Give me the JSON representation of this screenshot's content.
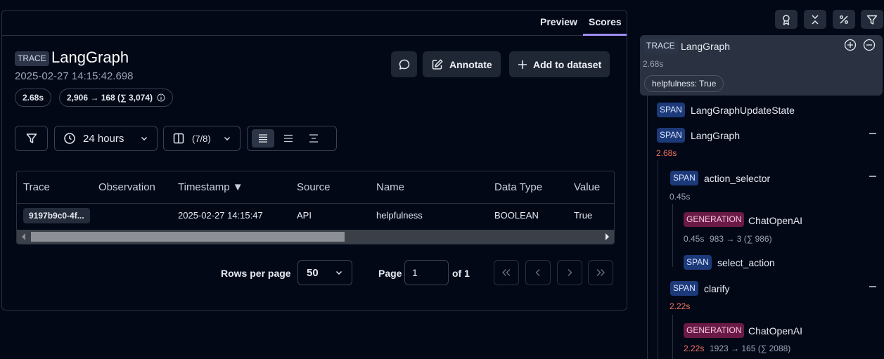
{
  "tabs": [
    {
      "label": "Preview"
    },
    {
      "label": "Scores"
    }
  ],
  "trace": {
    "badge": "TRACE",
    "name": "LangGraph",
    "timestamp": "2025-02-27 14:15:42.698",
    "latency": "2.68s",
    "tokens": "2,906 → 168 (∑ 3,074)"
  },
  "actions": {
    "annotate": "Annotate",
    "add_to_dataset": "Add to dataset"
  },
  "filters": {
    "time_range": "24 hours",
    "columns": "(7/8)"
  },
  "table": {
    "columns": [
      "Trace",
      "Observation",
      "Timestamp ▼",
      "Source",
      "Name",
      "Data Type",
      "Value"
    ],
    "rows": [
      {
        "trace": "9197b9c0-4f...",
        "observation": "",
        "timestamp": "2025-02-27 14:15:47",
        "source": "API",
        "name": "helpfulness",
        "data_type": "BOOLEAN",
        "value": "True"
      }
    ],
    "scroll_fraction": 0.55
  },
  "pagination": {
    "rows_label": "Rows per page",
    "rows_value": "50",
    "page_label": "Page",
    "page_value": "1",
    "of_label": "of 1"
  },
  "tree": {
    "root": {
      "badge": "TRACE",
      "name": "LangGraph",
      "duration": "2.68s",
      "score": "helpfulness: True"
    },
    "nodes": [
      {
        "badge": "SPAN",
        "name": "LangGraphUpdateState"
      },
      {
        "badge": "SPAN",
        "name": "LangGraph",
        "duration": "2.68s"
      },
      {
        "badge": "SPAN",
        "name": "action_selector",
        "duration": "0.45s"
      },
      {
        "badge": "GENERATION",
        "name": "ChatOpenAI",
        "duration": "0.45s",
        "tokens": "983 → 3 (∑ 986)"
      },
      {
        "badge": "SPAN",
        "name": "select_action"
      },
      {
        "badge": "SPAN",
        "name": "clarify",
        "duration": "2.22s"
      },
      {
        "badge": "GENERATION",
        "name": "ChatOpenAI",
        "duration": "2.22s",
        "tokens": "1923 → 165 (∑ 2088)"
      }
    ]
  },
  "colors": {
    "background": "#030817",
    "active_tab": "#9d8cf5",
    "span_badge": "#1c3a7a",
    "generation_badge": "#6b1a47",
    "slow_duration": "#f0735f"
  }
}
